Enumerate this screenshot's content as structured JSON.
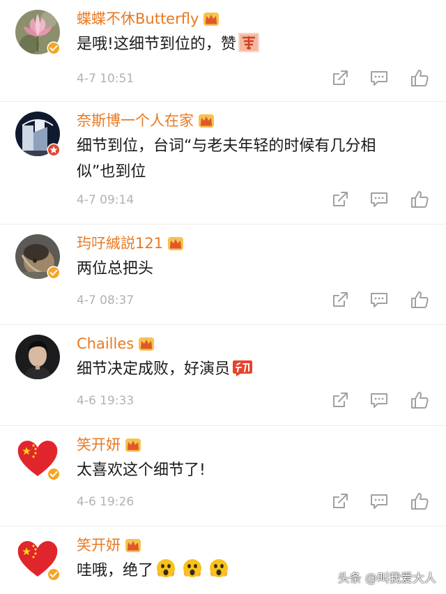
{
  "colors": {
    "username": "#e97920",
    "comment_text": "#1a1a1a",
    "timestamp": "#b2b2b2",
    "icon_gray": "#a0a0a0",
    "verified_badge": "#f5a623"
  },
  "comments": [
    {
      "username": "蝶蝶不休Butterfly",
      "text": "是哦!这细节到位的，赞",
      "emoji": "zan-sticker",
      "time": "4-7 10:51",
      "avatar": "pink-lotus-avatar",
      "badge": "crown-icon"
    },
    {
      "username": "奈斯博一个人在家",
      "text": "细节到位，台词“与老夫年轻的时候有几分相\n似”也到位",
      "time": "4-7 09:14",
      "avatar": "night-building-avatar",
      "badge": "crown-icon"
    },
    {
      "username": "玙吇絾説121",
      "text": "两位总把头",
      "time": "4-7 08:37",
      "avatar": "wet-hair-avatar",
      "badge": "crown-icon"
    },
    {
      "username": "Chailles",
      "text": "细节决定成败，好演员",
      "emoji": "geili-sticker",
      "time": "4-6 19:33",
      "avatar": "man-portrait-avatar",
      "badge": "crown-icon"
    },
    {
      "username": "笑开妍",
      "text": "太喜欢这个细节了!",
      "time": "4-6 19:26",
      "avatar": "flag-heart-avatar",
      "badge": "crown-icon"
    },
    {
      "username": "笑开妍",
      "text": "哇哦，绝了",
      "emoji": "shock-face-emoji-x3",
      "time": "",
      "avatar": "flag-heart-avatar",
      "badge": "crown-icon"
    }
  ],
  "actions": {
    "share_icon": "share-icon",
    "reply_icon": "reply-icon",
    "like_icon": "thumbs-up-icon"
  },
  "watermark": "头条 @叫我爱大人"
}
